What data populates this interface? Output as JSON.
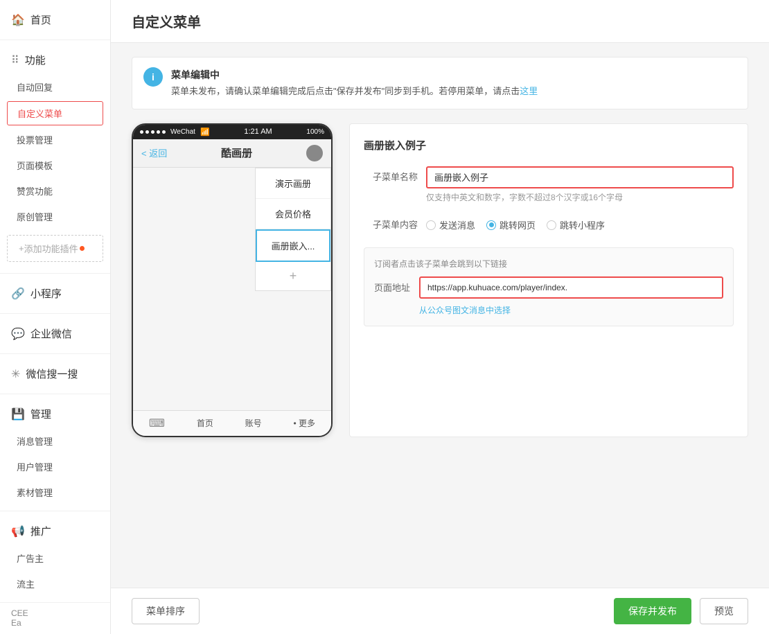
{
  "page": {
    "title": "自定义菜单"
  },
  "sidebar": {
    "home_label": "首页",
    "sections": [
      {
        "id": "features",
        "header": "功能",
        "items": [
          {
            "id": "auto-reply",
            "label": "自动回复",
            "active": false
          },
          {
            "id": "custom-menu",
            "label": "自定义菜单",
            "active": true
          },
          {
            "id": "vote-manage",
            "label": "投票管理",
            "active": false
          },
          {
            "id": "page-template",
            "label": "页面模板",
            "active": false
          },
          {
            "id": "reward",
            "label": "赞赏功能",
            "active": false
          },
          {
            "id": "original-manage",
            "label": "原创管理",
            "active": false
          }
        ],
        "add_plugin": "添加功能插件"
      },
      {
        "id": "miniprogram",
        "header": "小程序",
        "items": []
      },
      {
        "id": "enterprise-wechat",
        "header": "企业微信",
        "items": []
      },
      {
        "id": "wechat-search",
        "header": "微信搜一搜",
        "items": []
      },
      {
        "id": "management",
        "header": "管理",
        "items": [
          {
            "id": "msg-manage",
            "label": "消息管理",
            "active": false
          },
          {
            "id": "user-manage",
            "label": "用户管理",
            "active": false
          },
          {
            "id": "material-manage",
            "label": "素材管理",
            "active": false
          }
        ]
      },
      {
        "id": "promotion",
        "header": "推广",
        "items": [
          {
            "id": "advertiser",
            "label": "广告主",
            "active": false
          },
          {
            "id": "traffic-owner",
            "label": "流主",
            "active": false
          }
        ]
      }
    ]
  },
  "notice": {
    "icon": "i",
    "title": "菜单编辑中",
    "text": "菜单未发布，请确认菜单编辑完成后点击\"保存并发布\"同步到手机。若停用菜单，请点击这里",
    "link_text": "这里"
  },
  "phone": {
    "status_bar": {
      "dots": 5,
      "brand": "WeChat",
      "wifi": "wifi",
      "time": "1:21 AM",
      "battery": "100%"
    },
    "nav_bar": {
      "back": "< 返回",
      "title": "酷画册",
      "avatar": ""
    },
    "menu_items": [
      {
        "label": "演示画册",
        "active": false
      },
      {
        "label": "会员价格",
        "active": false
      },
      {
        "label": "画册嵌入...",
        "active": true
      }
    ],
    "add_label": "+",
    "bottom_bar": {
      "keyboard": "⌨",
      "items": [
        "首页",
        "账号",
        "• 更多"
      ]
    }
  },
  "right_panel": {
    "section_title": "画册嵌入例子",
    "form": {
      "name_label": "子菜单名称",
      "name_value": "画册嵌入例子",
      "name_placeholder": "画册嵌入例子",
      "name_hint": "仅支持中英文和数字，字数不超过8个汉字或16个字母",
      "content_label": "子菜单内容",
      "content_options": [
        {
          "label": "发送消息",
          "value": "send_msg",
          "checked": false
        },
        {
          "label": "跳转网页",
          "value": "redirect_web",
          "checked": true
        },
        {
          "label": "跳转小程序",
          "value": "redirect_miniapp",
          "checked": false
        }
      ],
      "url_hint": "订阅者点击该子菜单会跳到以下链接",
      "url_label": "页面地址",
      "url_value": "https://app.kuhuace.com/player/index.",
      "url_placeholder": "https://app.kuhuace.com/player/index.",
      "url_select_label": "从公众号图文消息中选择"
    }
  },
  "footer": {
    "sort_button": "菜单排序",
    "save_button": "保存并发布",
    "preview_button": "预览"
  },
  "bottom_sidebar": {
    "label1": "Ea",
    "label2": "CEE"
  }
}
